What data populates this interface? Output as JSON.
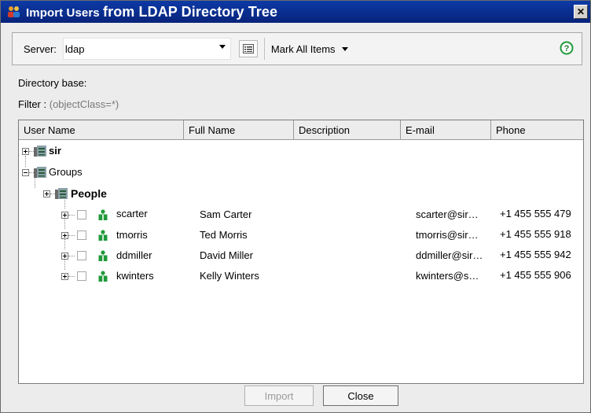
{
  "window": {
    "title_part1": "Import Users ",
    "title_part2": "from LDAP Directory Tree",
    "close_label": "✕"
  },
  "toolbar": {
    "server_label": "Server:",
    "server_value": "ldap",
    "mark_all_label": "Mark All Items"
  },
  "directory_base_label": "Directory base:",
  "filter": {
    "label": "Filter : ",
    "value": "(objectClass=*)"
  },
  "grid": {
    "columns": [
      "User Name",
      "Full Name",
      "Description",
      "E-mail",
      "Phone"
    ],
    "tree": {
      "sir": "sir",
      "groups": "Groups",
      "people": "People"
    },
    "users": [
      {
        "username": "scarter",
        "fullname": "Sam Carter",
        "email": "scarter@sir…",
        "phone": "+1 455 555 479"
      },
      {
        "username": "tmorris",
        "fullname": "Ted Morris",
        "email": "tmorris@sir…",
        "phone": "+1 455 555 918"
      },
      {
        "username": "ddmiller",
        "fullname": "David Miller",
        "email": "ddmiller@sir…",
        "phone": "+1 455 555 942"
      },
      {
        "username": "kwinters",
        "fullname": "Kelly Winters",
        "email": "kwinters@s…",
        "phone": "+1 455 555 906"
      }
    ]
  },
  "buttons": {
    "import": "Import",
    "close": "Close"
  },
  "colors": {
    "titlebar": "#0a2a8c",
    "user_icon": "#1f9a3a",
    "help_icon": "#1f9a3a"
  }
}
